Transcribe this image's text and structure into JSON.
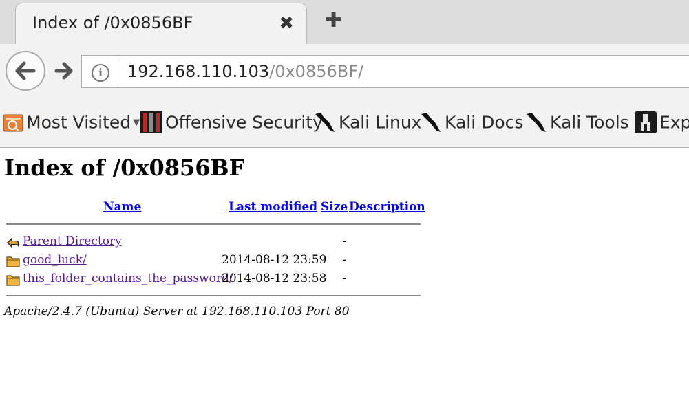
{
  "browser": {
    "tab": {
      "title": "Index of /0x0856BF",
      "close_glyph": "✖"
    },
    "newtab_glyph": "✚",
    "url": {
      "host": "192.168.110.103",
      "path": "/0x0856BF/"
    },
    "bookmarks": [
      {
        "label": "Most Visited",
        "icon": "most-visited-icon",
        "dropdown": true
      },
      {
        "label": "Offensive Security",
        "icon": "offensive-security-icon"
      },
      {
        "label": "Kali Linux",
        "icon": "kali-dragon-icon"
      },
      {
        "label": "Kali Docs",
        "icon": "kali-dragon-icon"
      },
      {
        "label": "Kali Tools",
        "icon": "kali-dragon-icon"
      },
      {
        "label": "Exp",
        "icon": "exploit-db-icon"
      }
    ]
  },
  "page": {
    "heading": "Index of /0x0856BF",
    "columns": {
      "name": "Name",
      "last_modified": "Last modified",
      "size": "Size",
      "description": "Description"
    },
    "rows": [
      {
        "icon": "parent-directory-icon",
        "name": "Parent Directory",
        "modified": "",
        "size": "-"
      },
      {
        "icon": "folder-icon",
        "name": "good_luck/",
        "modified": "2014-08-12 23:59",
        "size": "-"
      },
      {
        "icon": "folder-icon",
        "name": "this_folder_contains_the_password/",
        "modified": "2014-08-12 23:58",
        "size": "-"
      }
    ],
    "address": "Apache/2.4.7 (Ubuntu) Server at 192.168.110.103 Port 80"
  }
}
